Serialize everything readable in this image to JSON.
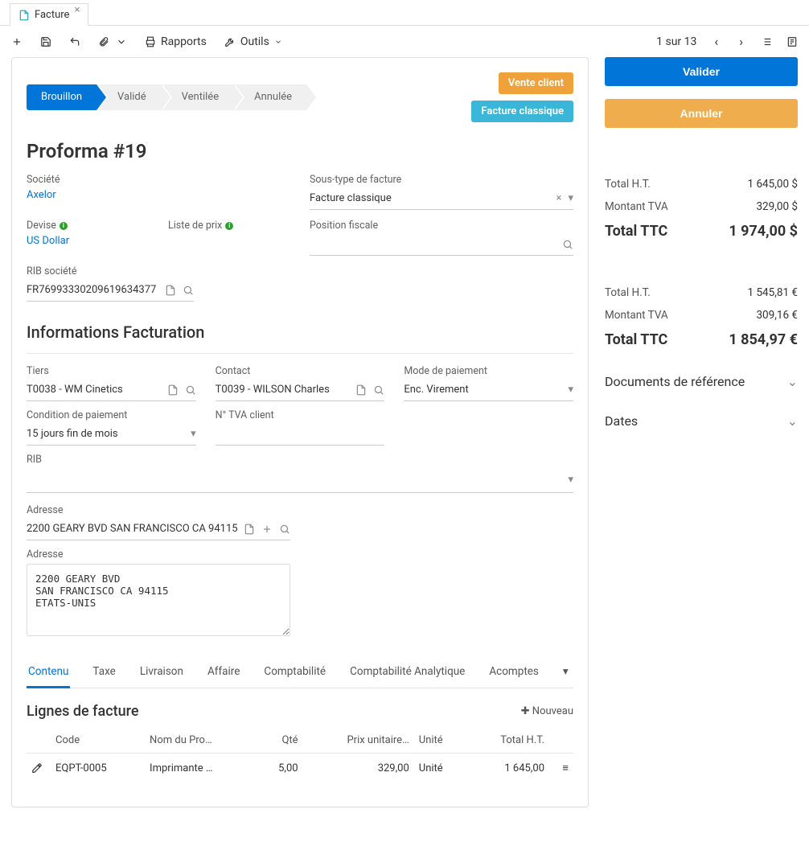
{
  "tab": {
    "title": "Facture"
  },
  "toolbar": {
    "reports_label": "Rapports",
    "tools_label": "Outils",
    "pager": "1 sur 13"
  },
  "status": {
    "steps": [
      "Brouillon",
      "Validé",
      "Ventilée",
      "Annulée"
    ],
    "active_index": 0,
    "badge1": "Vente client",
    "badge2": "Facture classique"
  },
  "title": "Proforma #19",
  "fields": {
    "company_label": "Société",
    "company_value": "Axelor",
    "subtype_label": "Sous-type de facture",
    "subtype_value": "Facture classique",
    "currency_label": "Devise",
    "currency_value": "US Dollar",
    "pricelist_label": "Liste de prix",
    "fiscal_position_label": "Position fiscale",
    "company_rib_label": "RIB société",
    "company_rib_value": "FR7699333020961963437­7",
    "company_rib_value_plain": "FR76993330209619634377"
  },
  "billing": {
    "section_title": "Informations Facturation",
    "partner_label": "Tiers",
    "partner_value": "T0038 - WM Cinetics",
    "contact_label": "Contact",
    "contact_value": "T0039 - WILSON Charles",
    "payment_mode_label": "Mode de paiement",
    "payment_mode_value": "Enc. Virement",
    "payment_cond_label": "Condition de paiement",
    "payment_cond_value": "15 jours fin de mois",
    "vat_label": "N° TVA client",
    "rib_label": "RIB",
    "address_label": "Adresse",
    "address_inline": "2200 GEARY BVD SAN FRANCISCO CA 94115",
    "address_block_label": "Adresse",
    "address_block": "2200 GEARY BVD\nSAN FRANCISCO CA 94115\nETATS-UNIS"
  },
  "tabs": {
    "items": [
      "Contenu",
      "Taxe",
      "Livraison",
      "Affaire",
      "Comptabilité",
      "Comptabilité Analytique",
      "Acomptes"
    ],
    "active_index": 0
  },
  "lines": {
    "title": "Lignes de facture",
    "new_label": "Nouveau",
    "headers": {
      "code": "Code",
      "name": "Nom du Pro…",
      "qty": "Qté",
      "unit_price": "Prix unitaire…",
      "unit": "Unité",
      "total_ht": "Total H.T."
    },
    "rows": [
      {
        "code": "EQPT-0005",
        "name": "Imprimante …",
        "qty": "5,00",
        "unit_price": "329,00",
        "unit": "Unité",
        "total_ht": "1 645,00"
      }
    ]
  },
  "side": {
    "validate": "Valider",
    "cancel": "Annuler",
    "totals_usd": {
      "ht_label": "Total H.T.",
      "ht": "1 645,00 $",
      "tva_label": "Montant TVA",
      "tva": "329,00 $",
      "ttc_label": "Total TTC",
      "ttc": "1 974,00 $"
    },
    "totals_eur": {
      "ht_label": "Total H.T.",
      "ht": "1 545,81 €",
      "tva_label": "Montant TVA",
      "tva": "309,16 €",
      "ttc_label": "Total TTC",
      "ttc": "1 854,97 €"
    },
    "ref_docs": "Documents de référence",
    "dates": "Dates"
  }
}
